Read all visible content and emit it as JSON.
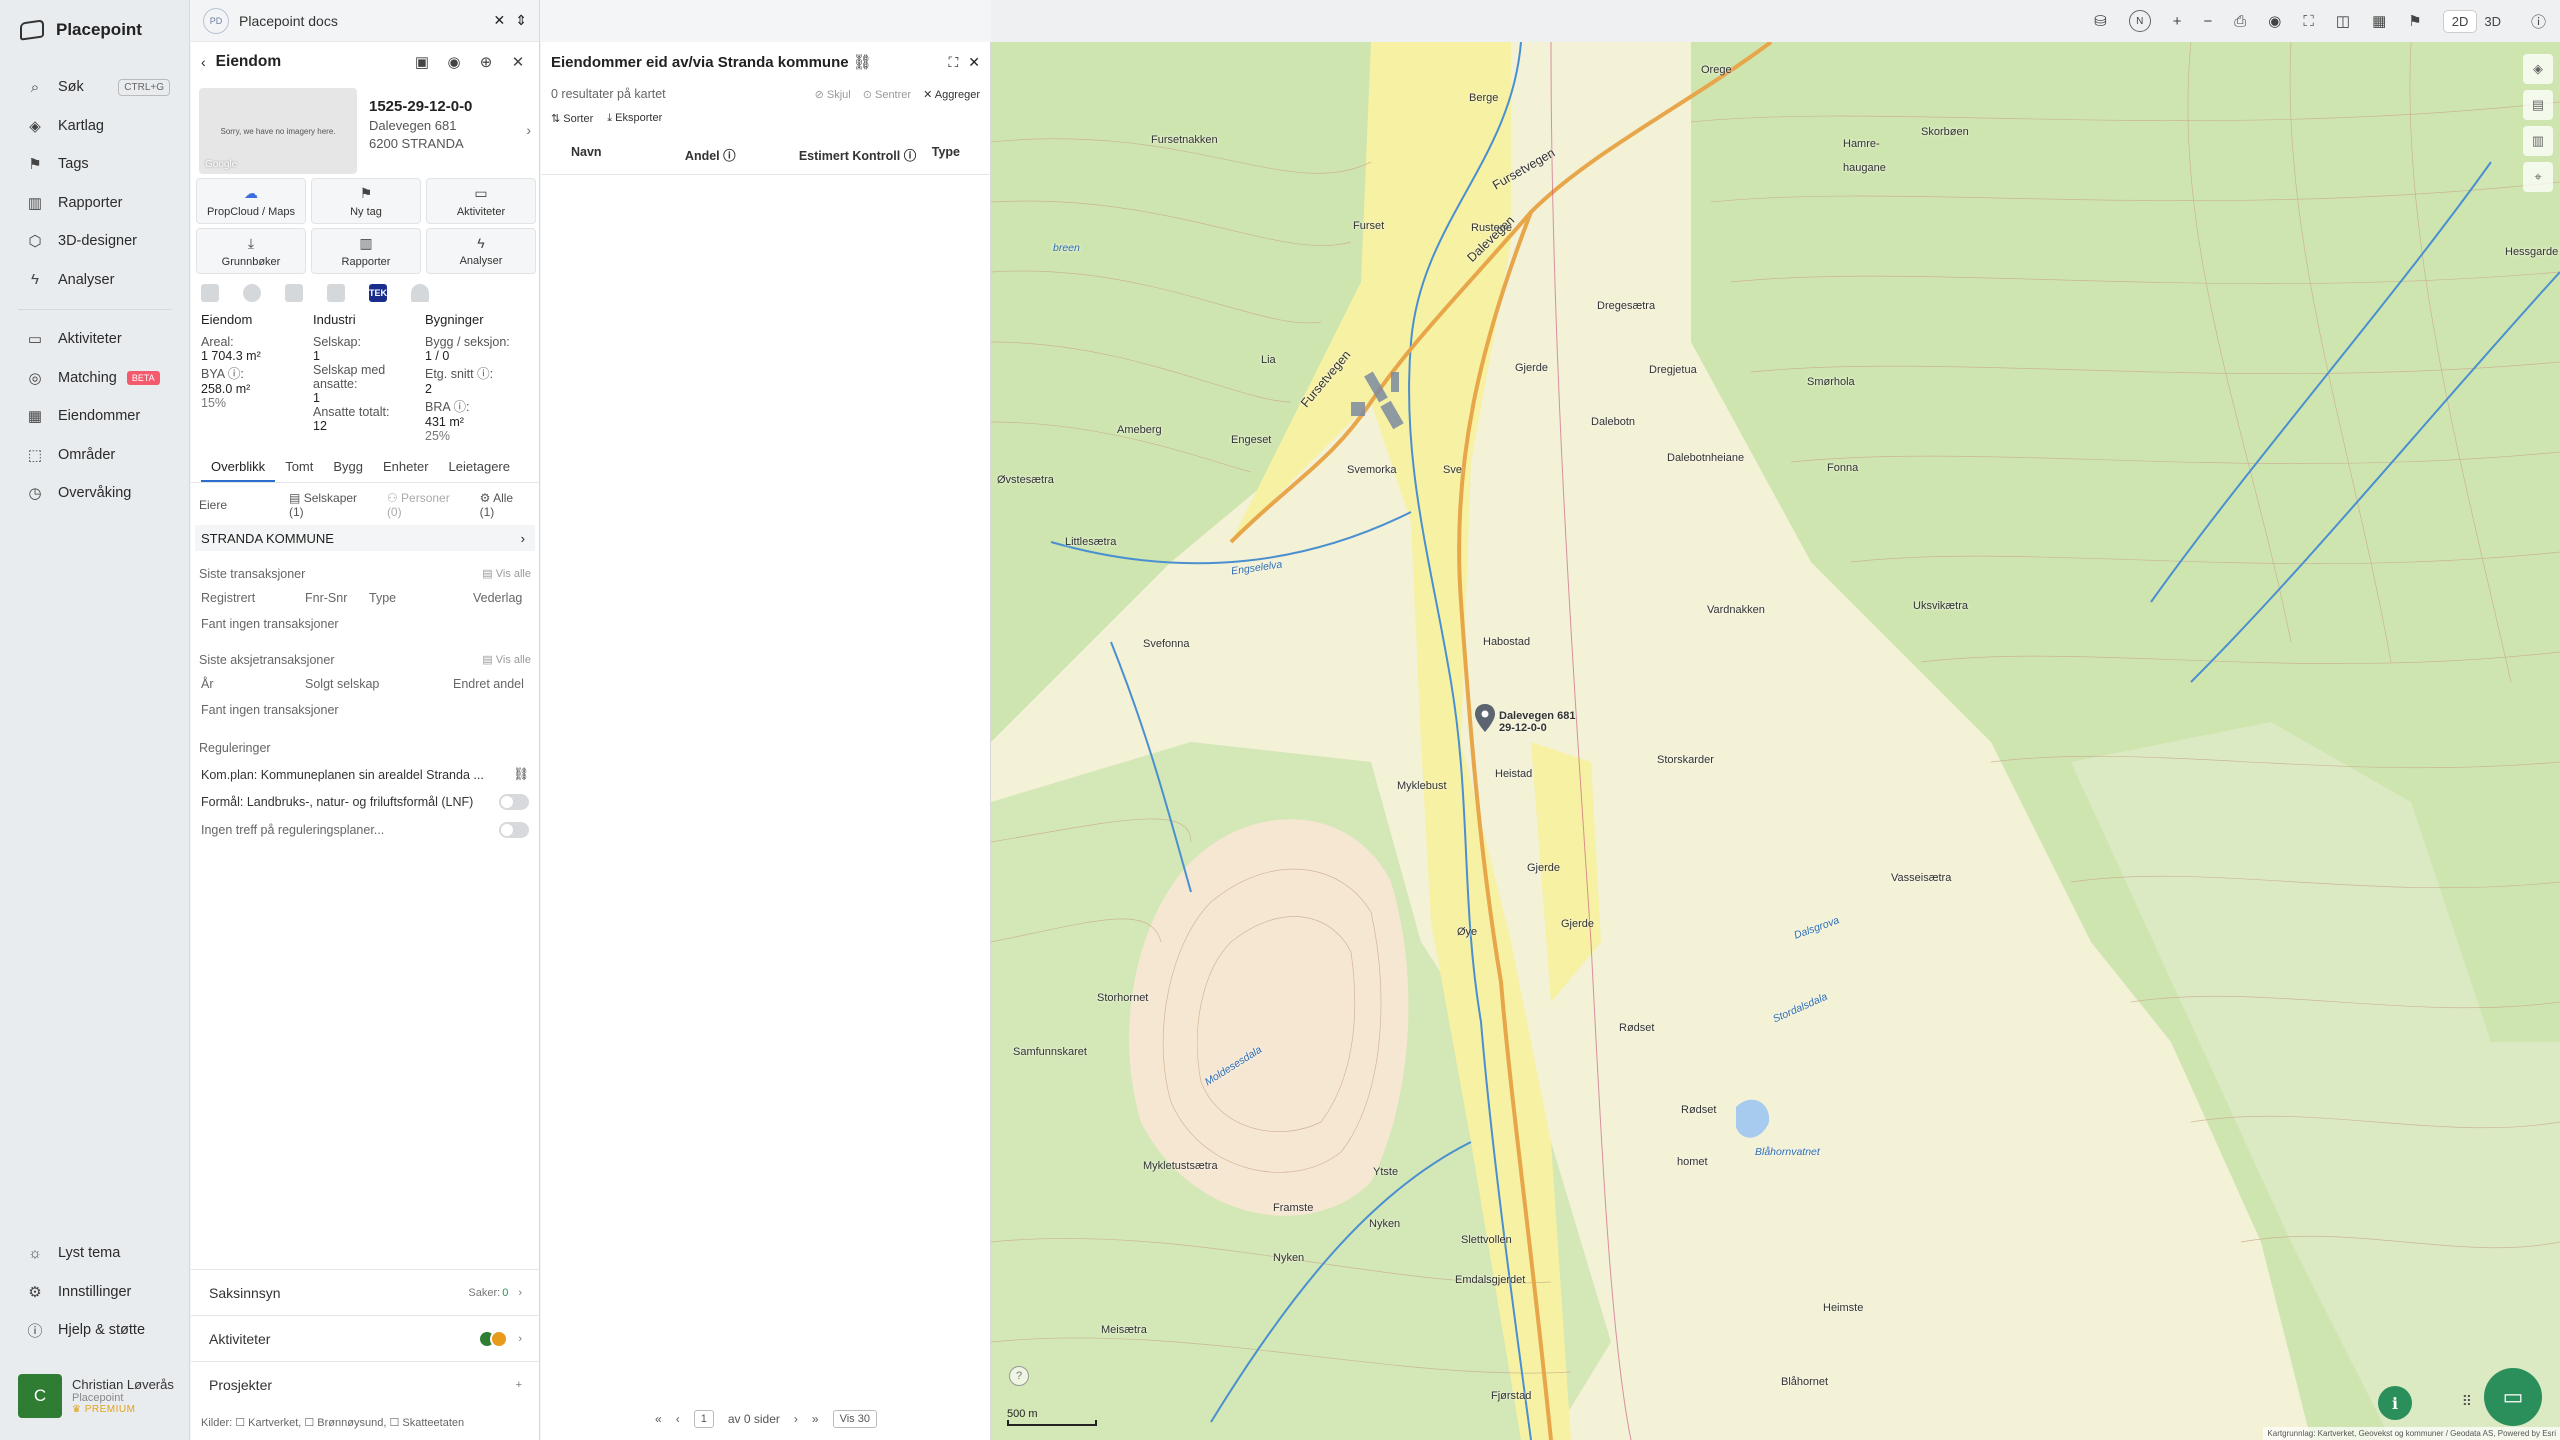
{
  "app": {
    "name": "Placepoint"
  },
  "nav": {
    "items": [
      {
        "label": "Søk",
        "icon": "search-icon",
        "shortcut": "CTRL+G"
      },
      {
        "label": "Kartlag",
        "icon": "layers-icon"
      },
      {
        "label": "Tags",
        "icon": "bookmark-icon"
      },
      {
        "label": "Rapporter",
        "icon": "chart-icon"
      },
      {
        "label": "3D-designer",
        "icon": "cube-icon"
      },
      {
        "label": "Analyser",
        "icon": "bolt-icon"
      }
    ],
    "items2": [
      {
        "label": "Aktiviteter",
        "icon": "chat-icon"
      },
      {
        "label": "Matching",
        "icon": "target-icon",
        "badge": "BETA"
      },
      {
        "label": "Eiendommer",
        "icon": "building-icon"
      },
      {
        "label": "Områder",
        "icon": "area-icon"
      },
      {
        "label": "Overvåking",
        "icon": "clock-icon"
      }
    ],
    "bottom": [
      {
        "label": "Lyst tema",
        "icon": "sun-icon"
      },
      {
        "label": "Innstillinger",
        "icon": "gear-icon"
      },
      {
        "label": "Hjelp & støtte",
        "icon": "help-icon"
      }
    ],
    "user": {
      "initial": "C",
      "name": "Christian Løverås",
      "org": "Placepoint",
      "plan": "PREMIUM"
    }
  },
  "doctab": {
    "badge": "PD",
    "title": "Placepoint docs"
  },
  "property": {
    "header": "Eiendom",
    "id": "1525-29-12-0-0",
    "street": "Dalevegen 681",
    "postal": "6200 STRANDA",
    "noimage": "Sorry, we have no imagery here.",
    "google": "Google",
    "tiles": [
      {
        "label": "PropCloud / Maps",
        "icon": "cloud-icon"
      },
      {
        "label": "Ny tag",
        "icon": "bookmark-icon"
      },
      {
        "label": "Aktiviteter",
        "icon": "chat-icon"
      },
      {
        "label": "Grunnbøker",
        "icon": "download-icon"
      },
      {
        "label": "Rapporter",
        "icon": "chart-icon"
      },
      {
        "label": "Analyser",
        "icon": "bolt-icon"
      }
    ],
    "tek": "TEK",
    "facts": {
      "eiendom": {
        "h": "Eiendom",
        "areal_l": "Areal:",
        "areal_v": "1 704.3 m²",
        "bya_l": "BYA ⓘ:",
        "bya_v": "258.0 m²",
        "bya_p": "15%"
      },
      "industri": {
        "h": "Industri",
        "selskap_l": "Selskap:",
        "selskap_v": "1",
        "ansatte_l": "Selskap med ansatte:",
        "ansatte_v": "1",
        "tot_l": "Ansatte totalt:",
        "tot_v": "12"
      },
      "bygninger": {
        "h": "Bygninger",
        "bygg_l": "Bygg / seksjon:",
        "bygg_v": "1 / 0",
        "etg_l": "Etg. snitt ⓘ:",
        "etg_v": "2",
        "bra_l": "BRA ⓘ:",
        "bra_v": "431 m²",
        "bra_p": "25%"
      }
    },
    "tabs": [
      "Overblikk",
      "Tomt",
      "Bygg",
      "Enheter",
      "Leietagere"
    ],
    "owners": {
      "label": "Eiere",
      "selskaper": "Selskaper (1)",
      "personer": "Personer (0)",
      "alle": "Alle (1)",
      "name": "STRANDA KOMMUNE"
    },
    "transactions": {
      "title": "Siste transaksjoner",
      "visall": "Vis alle",
      "cols": [
        "Registrert",
        "Fnr-Snr",
        "Type",
        "Vederlag"
      ],
      "empty": "Fant ingen transaksjoner"
    },
    "share_tx": {
      "title": "Siste aksjetransaksjoner",
      "visall": "Vis alle",
      "cols": [
        "År",
        "Solgt selskap",
        "Endret andel"
      ],
      "empty": "Fant ingen transaksjoner"
    },
    "reg": {
      "title": "Reguleringer",
      "plan": "Kom.plan: Kommuneplanen sin arealdel Stranda ...",
      "formal": "Formål: Landbruks-, natur- og friluftsformål (LNF)",
      "ingen": "Ingen treff på reguleringsplaner..."
    },
    "acc": [
      {
        "label": "Saksinnsyn",
        "right": "Saker:",
        "count": "0"
      },
      {
        "label": "Aktiviteter"
      },
      {
        "label": "Prosjekter",
        "right": "+"
      }
    ],
    "sources": "Kilder: ☐ Kartverket, ☐ Brønnøysund, ☐ Skatteetaten"
  },
  "list": {
    "title": "Eiendommer eid av/via Stranda kommune",
    "subtitle": "0 resultater på kartet",
    "actions": {
      "hide": "Skjul",
      "center": "Sentrer",
      "aggregate": "Aggreger"
    },
    "tools": {
      "sort": "Sorter",
      "export": "Eksporter"
    },
    "cols": [
      "Navn",
      "Andel ⓘ",
      "Estimert Kontroll ⓘ",
      "Type"
    ],
    "pager": {
      "page": "1",
      "of": "av 0 sider",
      "show": "Vis 30"
    }
  },
  "map": {
    "labels": [
      {
        "t": "Fursetvegen",
        "c": "big"
      },
      {
        "t": "Dalevegen",
        "c": "big"
      },
      {
        "t": "Fursetvegen",
        "c": "big"
      },
      {
        "t": "Fursetnakken"
      },
      {
        "t": "Furset"
      },
      {
        "t": "Rustene"
      },
      {
        "t": "Berge"
      },
      {
        "t": "Orege"
      },
      {
        "t": "Skorbøen"
      },
      {
        "t": "Hamre-"
      },
      {
        "t": "haugane"
      },
      {
        "t": "Hessgarde"
      },
      {
        "t": "Dregesætra"
      },
      {
        "t": "Gjerde"
      },
      {
        "t": "Dregjetua"
      },
      {
        "t": "Smørhola"
      },
      {
        "t": "Dalebotn"
      },
      {
        "t": "Dalebotnheiane"
      },
      {
        "t": "Fonna"
      },
      {
        "t": "Lia"
      },
      {
        "t": "Ameberg"
      },
      {
        "t": "Engeset"
      },
      {
        "t": "Svemorka"
      },
      {
        "t": "Sve"
      },
      {
        "t": "Øvstesætra"
      },
      {
        "t": "Littlesætra"
      },
      {
        "t": "Svefonna"
      },
      {
        "t": "Habostad"
      },
      {
        "t": "Vardnakken"
      },
      {
        "t": "Uksvikætra"
      },
      {
        "t": "Dalevegen 681"
      },
      {
        "t": "29-12-0-0"
      },
      {
        "t": "Heistad"
      },
      {
        "t": "Myklebust"
      },
      {
        "t": "Storskarder"
      },
      {
        "t": "Gjerde"
      },
      {
        "t": "Gjerde"
      },
      {
        "t": "Øye"
      },
      {
        "t": "Vasseisætra"
      },
      {
        "t": "Storhornet"
      },
      {
        "t": "Rødset"
      },
      {
        "t": "Samfunnskaret"
      },
      {
        "t": "Rødset"
      },
      {
        "t": "homet"
      },
      {
        "t": "Mykletustsætra"
      },
      {
        "t": "Ytste"
      },
      {
        "t": "Framste"
      },
      {
        "t": "Nyken"
      },
      {
        "t": "Nyken"
      },
      {
        "t": "Slettvollen"
      },
      {
        "t": "Emdalsgjerdet"
      },
      {
        "t": "Meisætra"
      },
      {
        "t": "Heimste"
      },
      {
        "t": "Fjørstad"
      },
      {
        "t": "Blåhornet"
      },
      {
        "t": "Blåhornvatnet",
        "c": "water"
      },
      {
        "t": "Engselelva",
        "c": "water"
      },
      {
        "t": "Moldesesdala",
        "c": "water"
      },
      {
        "t": "Stordalsdala",
        "c": "water"
      },
      {
        "t": "Dalsgrova",
        "c": "water"
      },
      {
        "t": "breen",
        "c": "water"
      }
    ],
    "scale": "500 m",
    "attribution": "Kartgrunnlag: Kartverket, Geovekst og kommuner / Geodata AS, Powered by Esri"
  },
  "topbar": {
    "north": "N",
    "modes": [
      "2D",
      "3D"
    ]
  }
}
